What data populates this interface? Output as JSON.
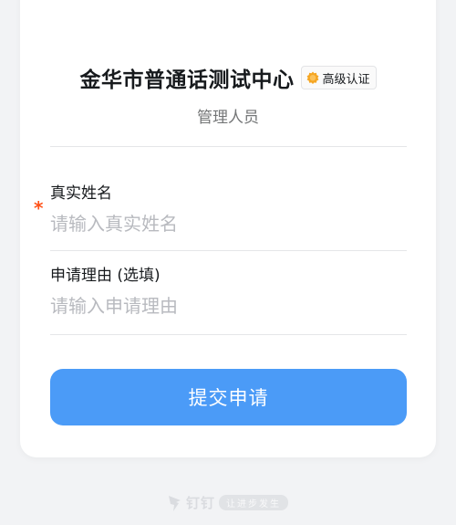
{
  "header": {
    "org_name": "金华市普通话测试中心",
    "badge_label": "高级认证",
    "badge_icon": "certified-badge-icon",
    "badge_color": "#f5a623",
    "subtitle": "管理人员"
  },
  "form": {
    "name_field": {
      "label": "真实姓名",
      "placeholder": "请输入真实姓名",
      "value": "",
      "required_mark": "*"
    },
    "reason_field": {
      "label": "申请理由 (选填)",
      "placeholder": "请输入申请理由",
      "value": ""
    },
    "submit_label": "提交申请"
  },
  "footer": {
    "brand": "钉钉",
    "slogan": "让进步发生"
  },
  "colors": {
    "primary_button": "#4b9bf7",
    "required_star": "#ff5219"
  }
}
